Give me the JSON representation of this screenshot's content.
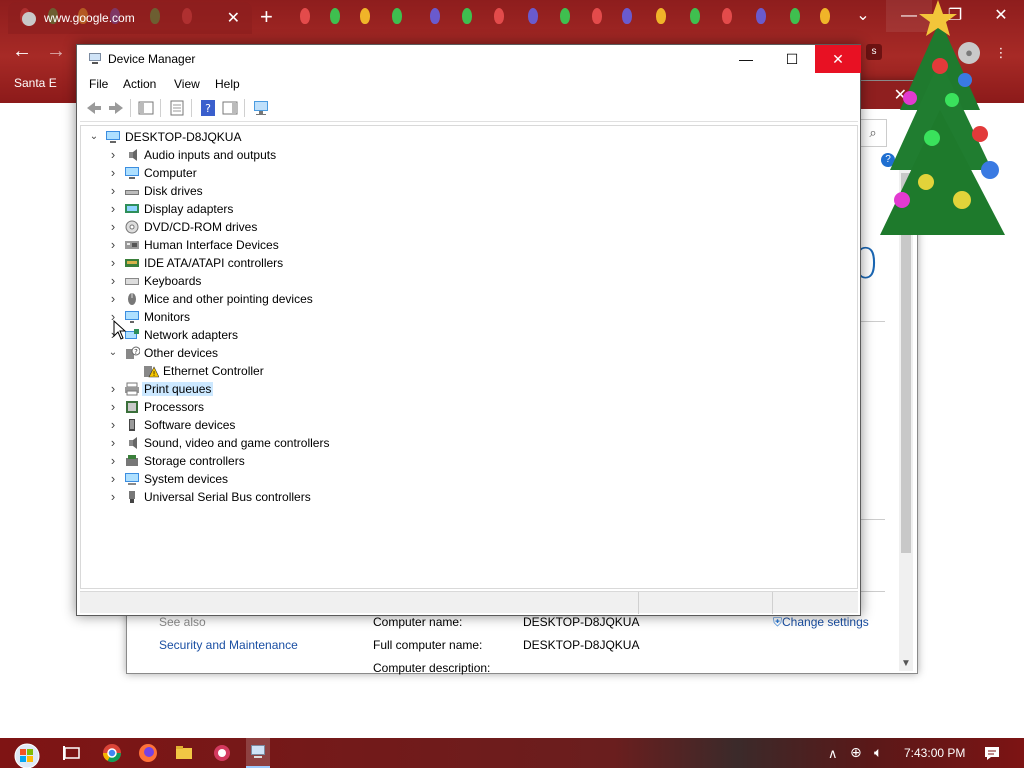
{
  "browser": {
    "tab_title": "www.google.com",
    "tab_close": "✕",
    "new_tab": "+",
    "bookmark": "Santa E",
    "profile_initial": "s"
  },
  "system_properties": {
    "search_icon": "⌕",
    "big_digit": "0",
    "see_also": "See also",
    "security_link": "Security and Maintenance",
    "computer_name_label": "Computer name:",
    "computer_name_value": "DESKTOP-D8JQKUA",
    "full_name_label": "Full computer name:",
    "full_name_value": "DESKTOP-D8JQKUA",
    "description_label": "Computer description:",
    "change_settings": "Change settings"
  },
  "device_manager": {
    "title": "Device Manager",
    "menu": [
      "File",
      "Action",
      "View",
      "Help"
    ],
    "root": "DESKTOP-D8JQKUA",
    "items": [
      {
        "label": "Audio inputs and outputs",
        "icon": "speaker-icon",
        "expanded": false
      },
      {
        "label": "Computer",
        "icon": "computer-icon",
        "expanded": false
      },
      {
        "label": "Disk drives",
        "icon": "disk-drive-icon",
        "expanded": false
      },
      {
        "label": "Display adapters",
        "icon": "display-adapter-icon",
        "expanded": false
      },
      {
        "label": "DVD/CD-ROM drives",
        "icon": "dvd-drive-icon",
        "expanded": false
      },
      {
        "label": "Human Interface Devices",
        "icon": "hid-icon",
        "expanded": false
      },
      {
        "label": "IDE ATA/ATAPI controllers",
        "icon": "ide-controller-icon",
        "expanded": false
      },
      {
        "label": "Keyboards",
        "icon": "keyboard-icon",
        "expanded": false
      },
      {
        "label": "Mice and other pointing devices",
        "icon": "mouse-icon",
        "expanded": false
      },
      {
        "label": "Monitors",
        "icon": "monitor-icon",
        "expanded": false
      },
      {
        "label": "Network adapters",
        "icon": "network-adapter-icon",
        "expanded": false
      },
      {
        "label": "Other devices",
        "icon": "unknown-device-icon",
        "expanded": true
      },
      {
        "label": "Ethernet Controller",
        "icon": "warning-device-icon",
        "child": true
      },
      {
        "label": "Print queues",
        "icon": "printer-icon",
        "expanded": false,
        "selected": true
      },
      {
        "label": "Processors",
        "icon": "processor-icon",
        "expanded": false
      },
      {
        "label": "Software devices",
        "icon": "software-device-icon",
        "expanded": false
      },
      {
        "label": "Sound, video and game controllers",
        "icon": "sound-controller-icon",
        "expanded": false
      },
      {
        "label": "Storage controllers",
        "icon": "storage-controller-icon",
        "expanded": false
      },
      {
        "label": "System devices",
        "icon": "system-device-icon",
        "expanded": false
      },
      {
        "label": "Universal Serial Bus controllers",
        "icon": "usb-icon",
        "expanded": false
      }
    ]
  },
  "taskbar": {
    "time": "7:43:00 PM"
  },
  "colors": {
    "accent_red": "#a72a26",
    "selection": "#cce8ff",
    "close_red": "#e81123",
    "link_blue": "#1a4fa3"
  }
}
